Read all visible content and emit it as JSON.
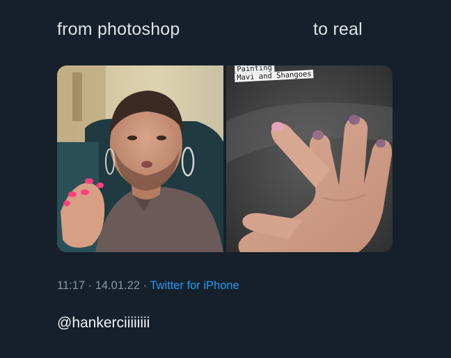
{
  "captions": {
    "left": "from photoshop",
    "right": "to real"
  },
  "media": {
    "left_image": "edited-photo-man-pink-nails",
    "right_image": "real-photo-hand-painted-nails",
    "story_text_line1": "Painting",
    "story_text_line2": "Mavi and Shangoes"
  },
  "tweet_meta": {
    "time": "11:17",
    "separator1": " · ",
    "date": "14.01.22",
    "separator2": " · ",
    "source": "Twitter for iPhone"
  },
  "handle": "@hankerciiiiiiii",
  "colors": {
    "background": "#15202b",
    "meta_text": "#8b98a5",
    "link": "#1d9bf0",
    "nail_pink": "#ff3f7f"
  }
}
